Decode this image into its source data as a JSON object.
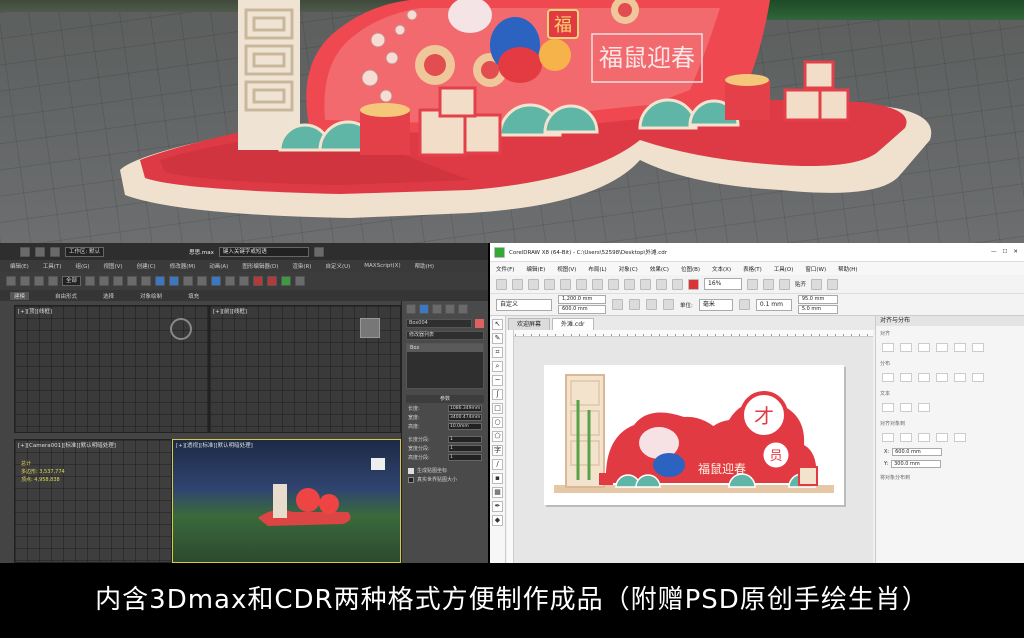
{
  "colors": {
    "festive_red": "#e23a42",
    "cloud_teal": "#5fb6a6",
    "cream": "#f3e3cf",
    "caption_bg": "#000000",
    "caption_text": "#ffffff",
    "viewport_active": "#d8c848"
  },
  "render": {
    "sign_text": "福鼠迎春",
    "fu_badge": "福"
  },
  "max": {
    "file_title": "思思.max",
    "search_placeholder": "键入关键字或短语",
    "workspace_label": "工作区: 默认",
    "menus": [
      "编辑(E)",
      "工具(T)",
      "组(G)",
      "视图(V)",
      "创建(C)",
      "修改器(M)",
      "动画(A)",
      "图形编辑器(D)",
      "渲染(R)",
      "自定义(U)",
      "MAXScript(X)",
      "帮助(H)"
    ],
    "view_select": "全部",
    "tabs": [
      "建模",
      "自由形式",
      "选择",
      "对象绘制",
      "填充"
    ],
    "viewports": {
      "top": "[+][顶][线框]",
      "front": "[+][前][线框]",
      "camera": "[+][Camera001][标准][默认明暗处理]",
      "perspective": "[+][透视][标准][默认明暗处理]"
    },
    "stats": [
      "总计",
      "多边形: 3,537,774",
      "顶点: 4,958,838"
    ],
    "cmd_panel": {
      "object_name": "Box004",
      "modifier_list": "修改器列表",
      "stack_item": "Box",
      "section_title": "参数",
      "params": [
        {
          "label": "长度:",
          "value": "1086.349mm"
        },
        {
          "label": "宽度:",
          "value": "3400.474mm"
        },
        {
          "label": "高度:",
          "value": "10.0mm"
        },
        {
          "label": "长度分段:",
          "value": "1"
        },
        {
          "label": "宽度分段:",
          "value": "1"
        },
        {
          "label": "高度分段:",
          "value": "1"
        }
      ],
      "checks": [
        "生成贴图坐标",
        "真实世界贴图大小"
      ]
    }
  },
  "cdr": {
    "title": "CorelDRAW X8 (64-Bit) - C:\\Users\\52598\\Desktop\\外滩.cdr",
    "menus": [
      "文件(F)",
      "编辑(E)",
      "视图(V)",
      "布局(L)",
      "对象(C)",
      "效果(C)",
      "位图(B)",
      "文本(X)",
      "表格(T)",
      "工具(O)",
      "窗口(W)",
      "帮助(H)"
    ],
    "zoom": "16%",
    "snap": "贴齐",
    "preset": "自定义",
    "width": "1,200.0 mm",
    "height": "600.0 mm",
    "units_label": "单位:",
    "units": "毫米",
    "nudge": "0.1 mm",
    "dup_x": "95.0 mm",
    "dup_y": "5.0 mm",
    "tabs": [
      "欢迎屏幕",
      "外滩.cdr"
    ],
    "design": {
      "title": "福鼠迎春",
      "char_1": "才",
      "char_2": "员"
    },
    "dock": {
      "header": "对齐与分布",
      "sections": [
        "对齐",
        "分布",
        "文本",
        "对齐对象到",
        "将对象分布到"
      ],
      "x_val": "600.0 mm",
      "y_val": "300.0 mm"
    }
  },
  "caption": "内含3Dmax和CDR两种格式方便制作成品（附赠PSD原创手绘生肖）"
}
